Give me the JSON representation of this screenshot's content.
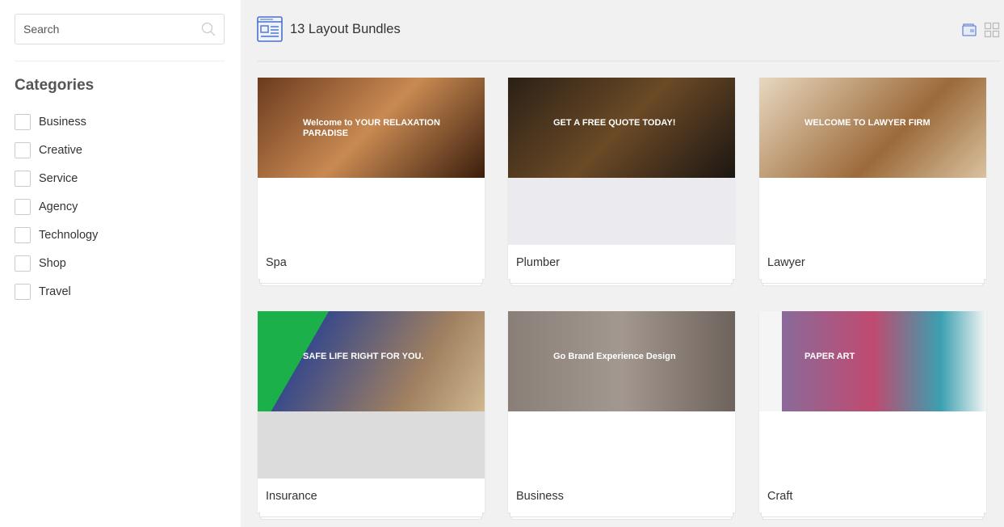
{
  "search": {
    "placeholder": "Search",
    "icon": "search-icon"
  },
  "categories": {
    "title": "Categories",
    "items": [
      "Business",
      "Creative",
      "Service",
      "Agency",
      "Technology",
      "Shop",
      "Travel"
    ]
  },
  "header": {
    "title": "13 Layout Bundles",
    "icon": "layout-icon"
  },
  "toolbar": {
    "icons": [
      "folder-icon",
      "grid-icon"
    ],
    "accent": "#5b7bd5"
  },
  "bundles": [
    {
      "name": "Spa",
      "thumb_text": "Welcome to YOUR RELAXATION PARADISE"
    },
    {
      "name": "Plumber",
      "thumb_text": "GET A FREE QUOTE TODAY!"
    },
    {
      "name": "Lawyer",
      "thumb_text": "WELCOME TO LAWYER FIRM"
    },
    {
      "name": "Insurance",
      "thumb_text": "SAFE LIFE RIGHT FOR YOU."
    },
    {
      "name": "Business",
      "thumb_text": "Go Brand Experience Design"
    },
    {
      "name": "Craft",
      "thumb_text": "PAPER ART"
    }
  ]
}
